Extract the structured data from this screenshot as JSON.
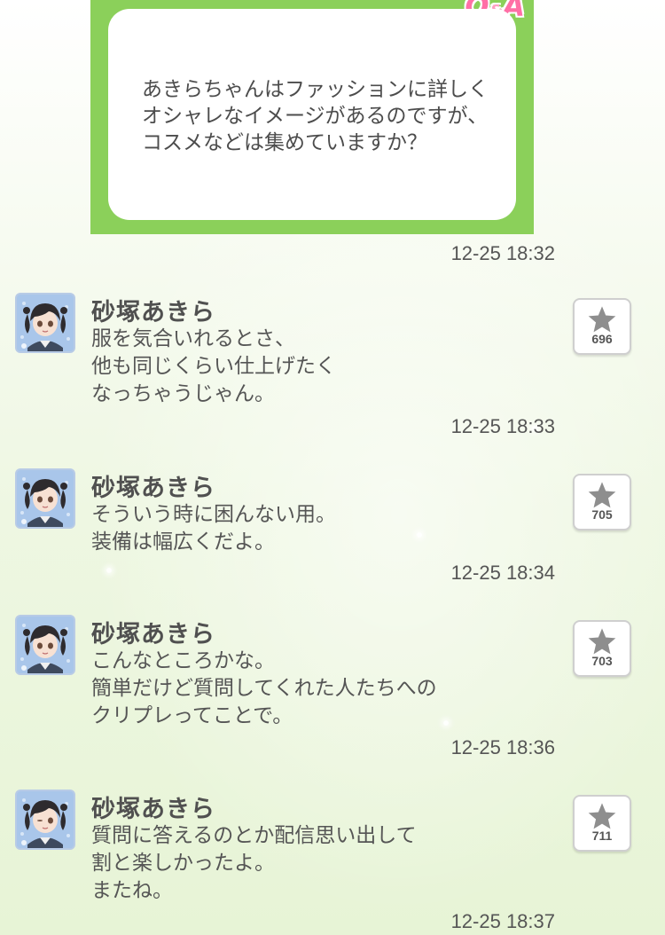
{
  "qa": {
    "badge_q": "Q",
    "badge_amp": "&",
    "badge_a": "A",
    "question": "あきらちゃんはファッションに詳しく\nオシャレなイメージがあるのですが、\nコスメなどは集めていますか？",
    "timestamp": "12-25 18:32"
  },
  "posts": [
    {
      "author": "砂塚あきら",
      "message": "服を気合いれるとさ、\n他も同じくらい仕上げたく\nなっちゃうじゃん。",
      "likes": "696",
      "timestamp": "12-25 18:33",
      "avatar_icon": "akira-avatar-icon"
    },
    {
      "author": "砂塚あきら",
      "message": "そういう時に困んない用。\n装備は幅広くだよ。",
      "likes": "705",
      "timestamp": "12-25 18:34",
      "avatar_icon": "akira-avatar-icon"
    },
    {
      "author": "砂塚あきら",
      "message": "こんなところかな。\n簡単だけど質問してくれた人たちへの\nクリプレってことで。",
      "likes": "703",
      "timestamp": "12-25 18:36",
      "avatar_icon": "akira-avatar-icon"
    },
    {
      "author": "砂塚あきら",
      "message": "質問に答えるのとか配信思い出して\n割と楽しかったよ。\nまたね。",
      "likes": "711",
      "timestamp": "12-25 18:37",
      "avatar_icon": "akira-wink-avatar-icon"
    }
  ],
  "colors": {
    "qa_frame": "#8bd05a",
    "badge": "#ff6fa6",
    "star": "#8e8e8e"
  }
}
